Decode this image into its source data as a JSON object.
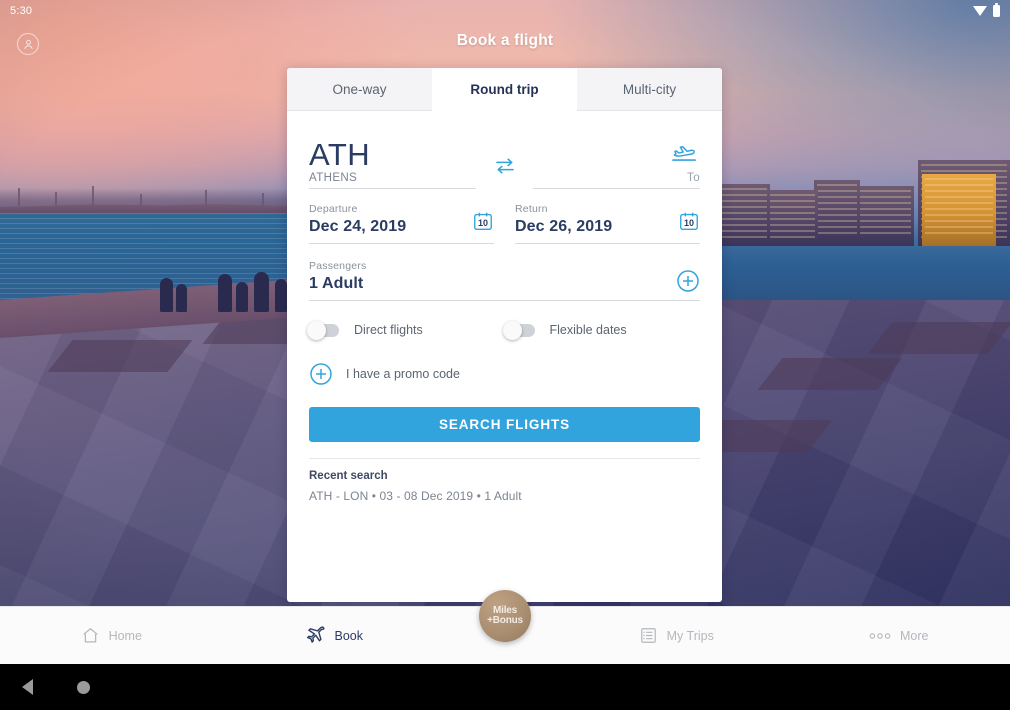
{
  "status_bar": {
    "time": "5:30",
    "icons": [
      "wifi-icon",
      "battery-icon"
    ]
  },
  "header": {
    "title": "Book a flight",
    "avatar_icon": "account-circle-icon"
  },
  "card": {
    "tabs": [
      {
        "label": "One-way",
        "active": false
      },
      {
        "label": "Round trip",
        "active": true
      },
      {
        "label": "Multi-city",
        "active": false
      }
    ],
    "route": {
      "origin_code": "ATH",
      "origin_city": "ATHENS",
      "swap_icon": "swap-horizontal-icon",
      "destination_icon": "airplane-takeoff-icon",
      "destination_placeholder": "To"
    },
    "departure": {
      "label": "Departure",
      "value": "Dec 24, 2019",
      "icon": "calendar-icon",
      "icon_day": "10"
    },
    "return": {
      "label": "Return",
      "value": "Dec 26, 2019",
      "icon": "calendar-icon",
      "icon_day": "10"
    },
    "passengers": {
      "label": "Passengers",
      "value": "1 Adult",
      "icon": "plus-circle-icon"
    },
    "options": [
      {
        "label": "Direct flights",
        "state": "off"
      },
      {
        "label": "Flexible dates",
        "state": "off"
      }
    ],
    "promo": {
      "label": "I have a promo code",
      "icon": "plus-circle-icon"
    },
    "search_button": "SEARCH FLIGHTS",
    "recent": {
      "title": "Recent search",
      "items": [
        "ATH - LON • 03 - 08 Dec 2019 • 1 Adult"
      ]
    }
  },
  "bottom_nav": {
    "items": [
      {
        "label": "Home",
        "icon": "home-icon",
        "active": false
      },
      {
        "label": "Book",
        "icon": "airplane-icon",
        "active": true
      },
      {
        "label": "My Trips",
        "icon": "list-icon",
        "active": false
      },
      {
        "label": "More",
        "icon": "more-dots-icon",
        "active": false
      }
    ],
    "center_badge": {
      "line1": "Miles",
      "line2": "+Bonus"
    }
  },
  "android_nav": {
    "back_icon": "back-triangle-icon",
    "home_icon": "home-circle-icon"
  },
  "colors": {
    "accent_blue": "#32a4dd",
    "navy": "#2b3c63",
    "badge_gold": "#ab8f72",
    "card_bg": "#ffffff"
  }
}
